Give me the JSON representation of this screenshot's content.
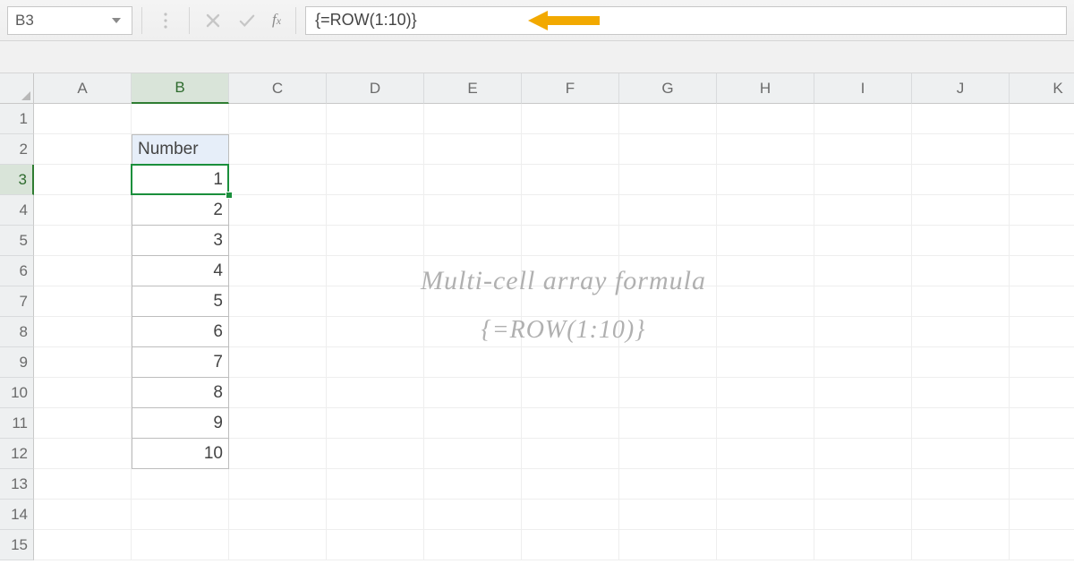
{
  "nameBox": {
    "value": "B3"
  },
  "formulaBar": {
    "value": "{=ROW(1:10)}"
  },
  "columns": [
    "A",
    "B",
    "C",
    "D",
    "E",
    "F",
    "G",
    "H",
    "I",
    "J",
    "K"
  ],
  "rows": [
    "1",
    "2",
    "3",
    "4",
    "5",
    "6",
    "7",
    "8",
    "9",
    "10",
    "11",
    "12",
    "13",
    "14",
    "15"
  ],
  "activeColumn": "B",
  "activeRow": "3",
  "header": {
    "label": "Number"
  },
  "values": [
    "1",
    "2",
    "3",
    "4",
    "5",
    "6",
    "7",
    "8",
    "9",
    "10"
  ],
  "annotation": {
    "line1": "Multi-cell array formula",
    "line2": "{=ROW(1:10)}"
  },
  "colors": {
    "selectionGreen": "#1a8f3c",
    "arrowOrange": "#f2a900",
    "headerFill": "#e6eef9"
  }
}
